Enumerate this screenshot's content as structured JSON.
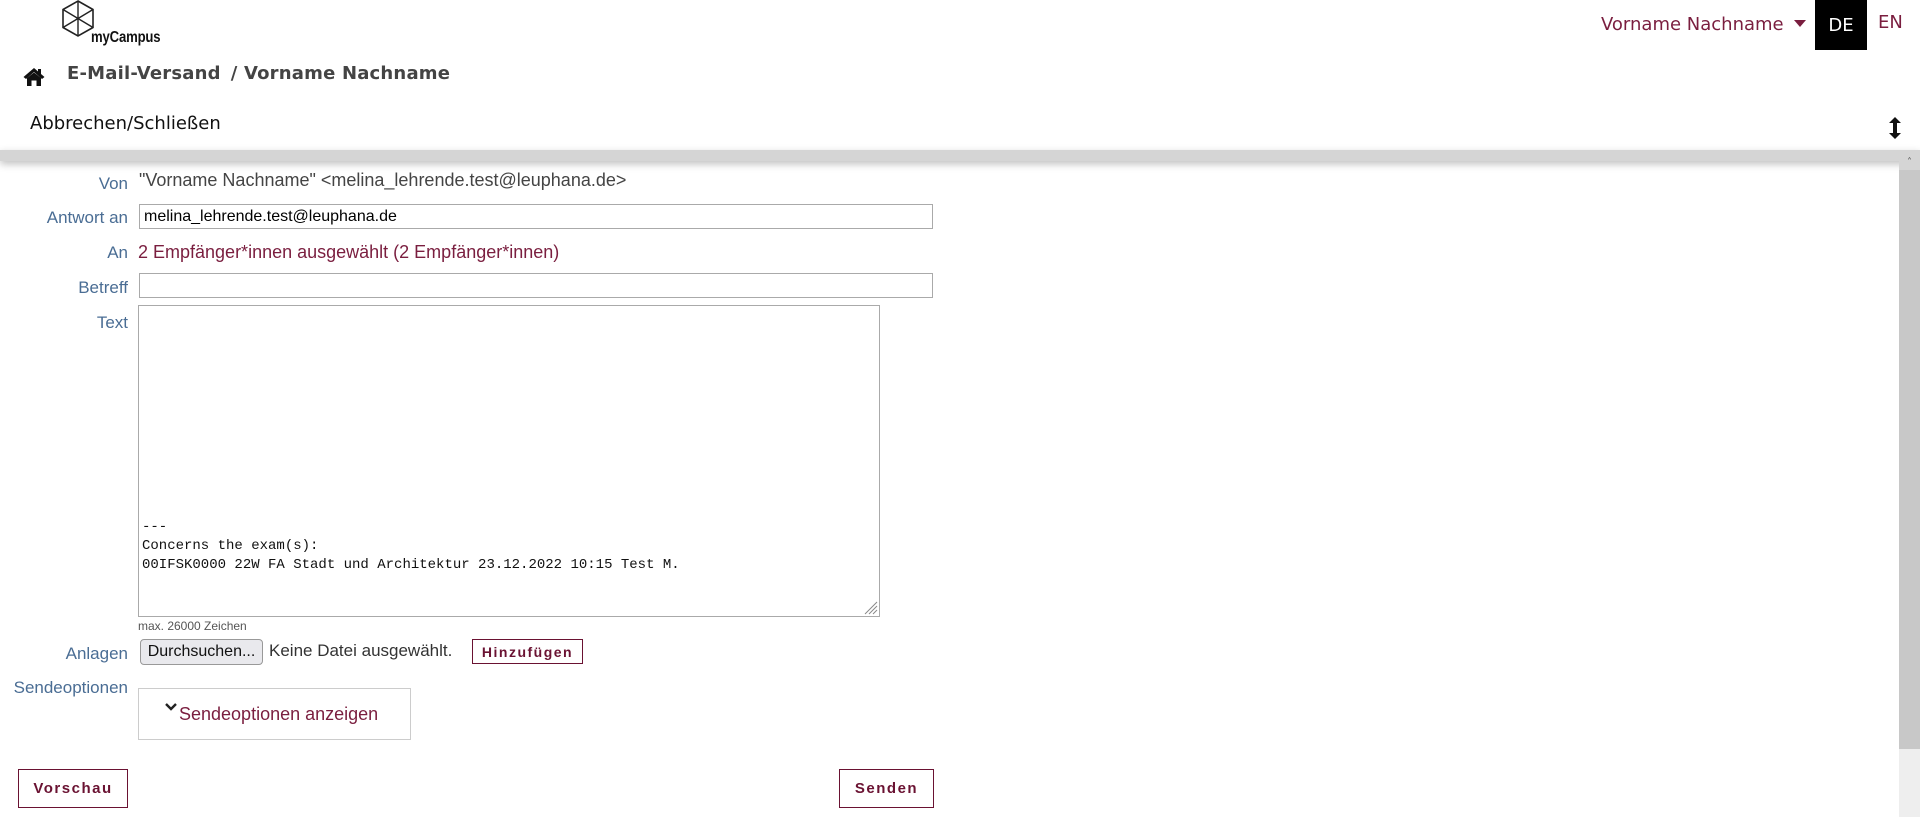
{
  "header": {
    "logo_text": "myCampus",
    "user_menu_label": "Vorname Nachname",
    "languages": [
      {
        "code": "DE",
        "active": true
      },
      {
        "code": "EN",
        "active": false
      }
    ],
    "breadcrumb": {
      "home_icon": "home-icon",
      "items": [
        "E-Mail-Versand",
        "/ Vorname Nachname"
      ]
    },
    "toolbar": {
      "cancel_close_label": "Abbrechen/Schließen",
      "resize_icon": "vertical-resize-icon"
    }
  },
  "form": {
    "from": {
      "label": "Von",
      "value": "\"Vorname Nachname\" <melina_lehrende.test@leuphana.de>"
    },
    "reply_to": {
      "label": "Antwort an",
      "value": "melina_lehrende.test@leuphana.de"
    },
    "to": {
      "label": "An",
      "value": "2 Empfänger*innen ausgewählt (2 Empfänger*innen)"
    },
    "subject": {
      "label": "Betreff",
      "value": ""
    },
    "text": {
      "label": "Text",
      "value": "---\nConcerns the exam(s):\n00IFSK0000 22W FA Stadt und Architektur 23.12.2022 10:15 Test M.",
      "hint": "max. 26000 Zeichen"
    },
    "attachments": {
      "label": "Anlagen",
      "browse_label": "Durchsuchen...",
      "no_file_label": "Keine Datei ausgewählt.",
      "add_label": "Hinzufügen"
    },
    "send_options": {
      "label": "Sendeoptionen",
      "toggle_label": "Sendeoptionen anzeigen"
    }
  },
  "actions": {
    "preview_label": "Vorschau",
    "send_label": "Senden"
  },
  "colors": {
    "accent": "#7a1e3f",
    "label": "#4a6d94",
    "active_lang_bg": "#000000"
  }
}
